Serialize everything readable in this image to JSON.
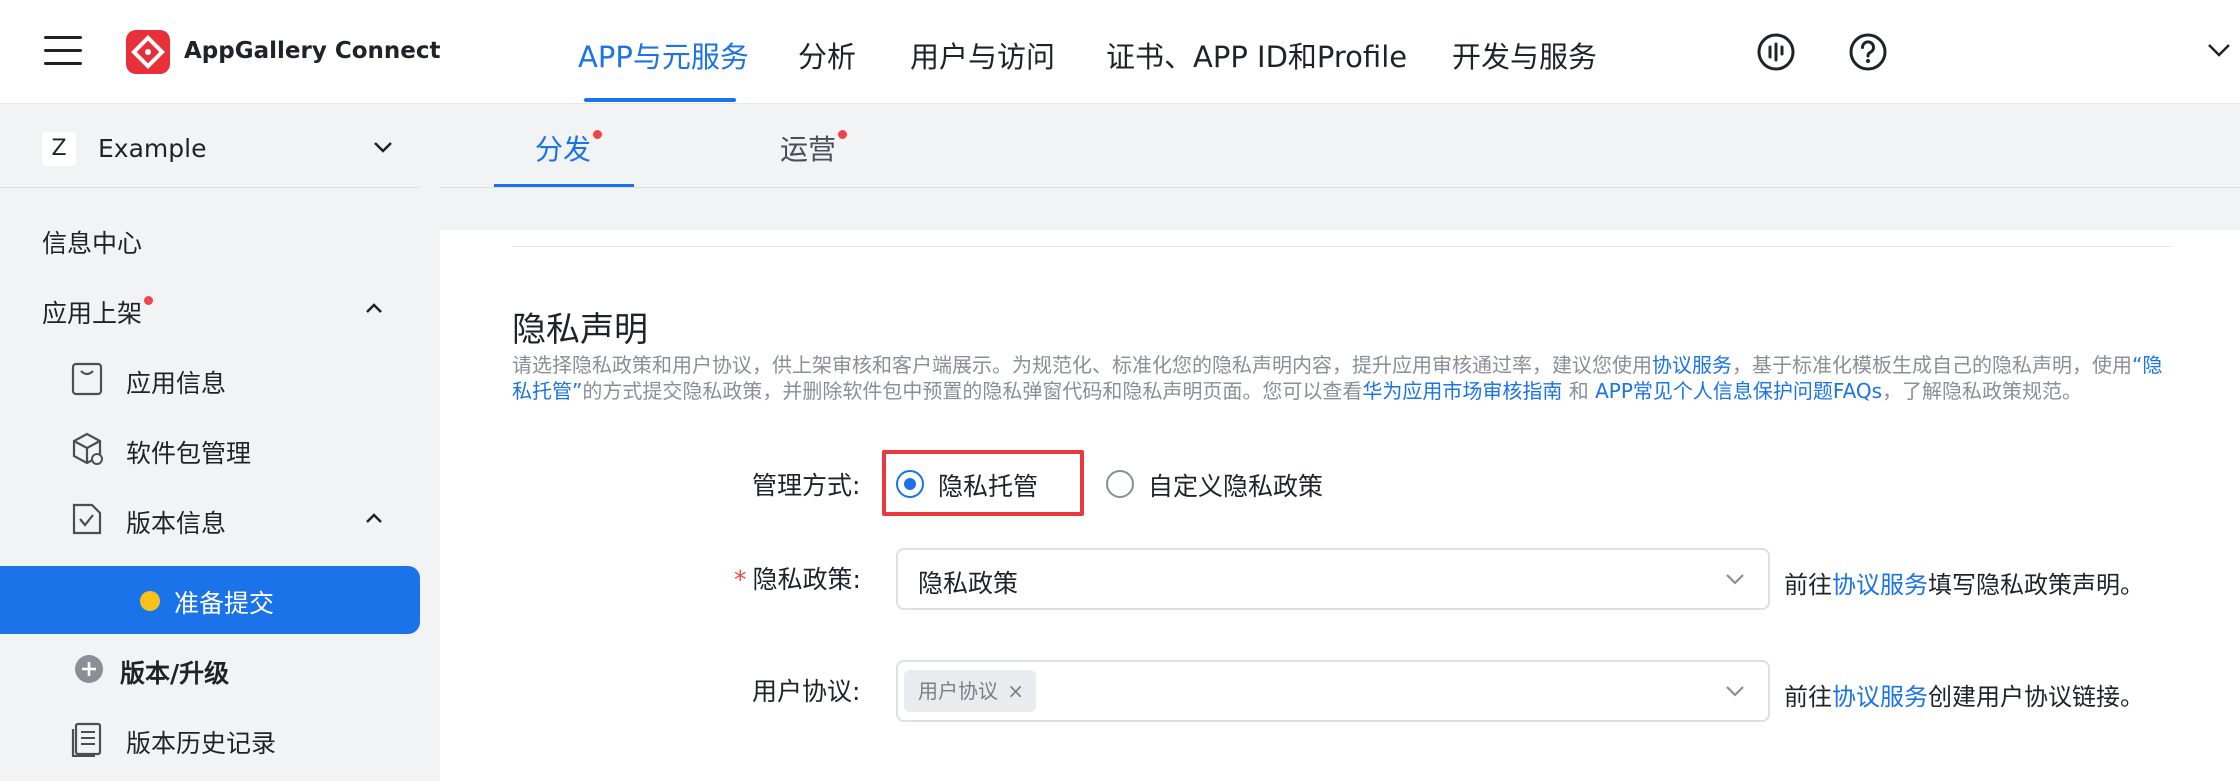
{
  "header": {
    "brand": "AppGallery Connect",
    "nav": [
      {
        "label": "APP与元服务",
        "active": true
      },
      {
        "label": "分析"
      },
      {
        "label": "用户与访问"
      },
      {
        "label": "证书、APP ID和Profile"
      },
      {
        "label": "开发与服务"
      }
    ],
    "icons": [
      "feedback-icon",
      "help-icon",
      "chevron-down-icon"
    ]
  },
  "sidebar": {
    "app": {
      "avatar": "Z",
      "name": "Example"
    },
    "items": [
      {
        "label": "信息中心"
      },
      {
        "label": "应用上架"
      },
      {
        "label": "应用信息"
      },
      {
        "label": "软件包管理"
      },
      {
        "label": "版本信息"
      },
      {
        "label": "准备提交"
      },
      {
        "label": "版本/升级"
      },
      {
        "label": "版本历史记录"
      }
    ]
  },
  "tabs": [
    {
      "label": "分发",
      "active": true
    },
    {
      "label": "运营"
    }
  ],
  "privacy": {
    "title": "隐私声明",
    "desc": {
      "p1": "请选择隐私政策和用户协议，供上架审核和客户端展示。为规范化、标准化您的隐私声明内容，提升应用审核通过率，建议您使用",
      "link1": "协议服务",
      "p2": "，基于标准化模板生成自己的隐私声明，使用",
      "link2": "“隐私托管”",
      "p3": "的方式提交隐私政策，并删除软件包中预置的隐私弹窗代码和隐私声明页面。您可以查看",
      "link3": "华为应用市场审核指南",
      "p4": " 和 ",
      "link4": "APP常见个人信息保护问题FAQs",
      "p5": "，了解隐私政策规范。"
    },
    "mode_label": "管理方式:",
    "mode_options": [
      {
        "label": "隐私托管",
        "checked": true
      },
      {
        "label": "自定义隐私政策",
        "checked": false
      }
    ],
    "policy_required": "*",
    "policy_label": "隐私政策:",
    "policy_value": "隐私政策",
    "policy_hint_pre": "前往",
    "policy_hint_link": "协议服务",
    "policy_hint_post": "填写隐私政策声明。",
    "agreement_label": "用户协议:",
    "agreement_tag": "用户协议",
    "agreement_tag_close": "×",
    "agreement_hint_pre": "前往",
    "agreement_hint_link": "协议服务",
    "agreement_hint_post": "创建用户协议链接。"
  },
  "colors": {
    "accent": "#1a73e8",
    "highlight": "#e8393f",
    "brand": "#e8303a"
  }
}
